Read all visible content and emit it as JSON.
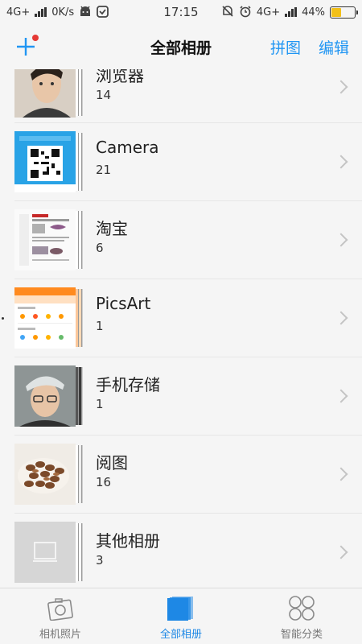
{
  "status_bar": {
    "network_left": "4G+",
    "speed": "0K/s",
    "time": "17:15",
    "network_right": "4G+",
    "battery_pct": "44%",
    "battery_level": 0.44,
    "battery_color": "#f2c019"
  },
  "header": {
    "title": "全部相册",
    "collage_label": "拼图",
    "edit_label": "编辑",
    "accent": "#2196f3",
    "badge_color": "#e53935"
  },
  "albums": [
    {
      "name": "浏览器",
      "count": "14"
    },
    {
      "name": "Camera",
      "count": "21"
    },
    {
      "name": "淘宝",
      "count": "6"
    },
    {
      "name": "PicsArt",
      "count": "1"
    },
    {
      "name": "手机存储",
      "count": "1"
    },
    {
      "name": "阅图",
      "count": "16"
    },
    {
      "name": "其他相册",
      "count": "3"
    }
  ],
  "tabs": [
    {
      "label": "相机照片",
      "icon": "camera-photos-icon"
    },
    {
      "label": "全部相册",
      "icon": "all-albums-icon",
      "active": true
    },
    {
      "label": "智能分类",
      "icon": "smart-categories-icon"
    }
  ]
}
